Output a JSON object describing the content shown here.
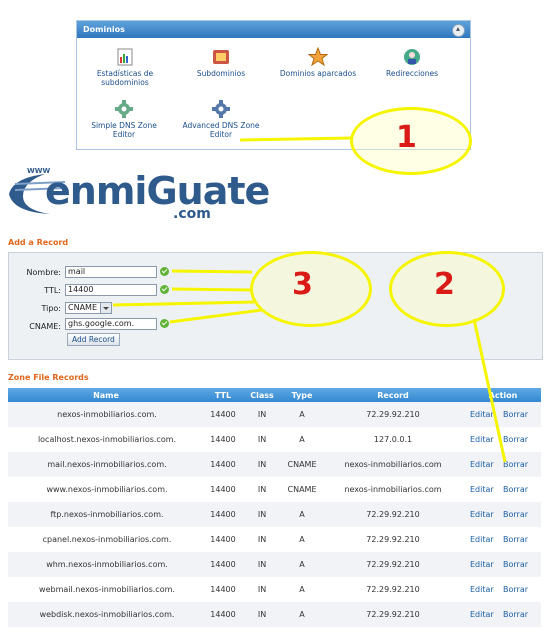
{
  "dominios": {
    "title": "Dominios",
    "items": [
      {
        "label": "Estadísticas de subdominios",
        "icon": "stats-icon"
      },
      {
        "label": "Subdominios",
        "icon": "subdomains-icon"
      },
      {
        "label": "Dominios aparcados",
        "icon": "parked-domains-icon"
      },
      {
        "label": "Redirecciones",
        "icon": "redirects-icon"
      },
      {
        "label": "Simple DNS Zone Editor",
        "icon": "simple-dns-icon"
      },
      {
        "label": "Advanced DNS Zone Editor",
        "icon": "advanced-dns-icon"
      }
    ]
  },
  "logo": {
    "text": "enmiGuate",
    "suffix": ".com",
    "prefix": "WWW"
  },
  "add_record": {
    "title": "Add a Record",
    "fields": {
      "nombre": {
        "label": "Nombre:",
        "value": "mail"
      },
      "ttl": {
        "label": "TTL:",
        "value": "14400"
      },
      "tipo": {
        "label": "Tipo:",
        "value": "CNAME"
      },
      "cname": {
        "label": "CNAME:",
        "value": "ghs.google.com."
      }
    },
    "button": "Add Record"
  },
  "zone": {
    "title": "Zone File Records",
    "headers": [
      "Name",
      "TTL",
      "Class",
      "Type",
      "Record",
      "Action"
    ],
    "rows": [
      [
        "nexos-inmobiliarios.com.",
        "14400",
        "IN",
        "A",
        "72.29.92.210"
      ],
      [
        "localhost.nexos-inmobiliarios.com.",
        "14400",
        "IN",
        "A",
        "127.0.0.1"
      ],
      [
        "mail.nexos-inmobiliarios.com.",
        "14400",
        "IN",
        "CNAME",
        "nexos-inmobiliarios.com"
      ],
      [
        "www.nexos-inmobiliarios.com.",
        "14400",
        "IN",
        "CNAME",
        "nexos-inmobiliarios.com"
      ],
      [
        "ftp.nexos-inmobiliarios.com.",
        "14400",
        "IN",
        "A",
        "72.29.92.210"
      ],
      [
        "cpanel.nexos-inmobiliarios.com.",
        "14400",
        "IN",
        "A",
        "72.29.92.210"
      ],
      [
        "whm.nexos-inmobiliarios.com.",
        "14400",
        "IN",
        "A",
        "72.29.92.210"
      ],
      [
        "webmail.nexos-inmobiliarios.com.",
        "14400",
        "IN",
        "A",
        "72.29.92.210"
      ],
      [
        "webdisk.nexos-inmobiliarios.com.",
        "14400",
        "IN",
        "A",
        "72.29.92.210"
      ]
    ],
    "edit_label": "Editar",
    "delete_label": "Borrar"
  },
  "annotations": {
    "one": "1",
    "two": "2",
    "three": "3"
  },
  "colors": {
    "accent_orange": "#e0661b",
    "header_blue": "#3389d1",
    "highlight_yellow": "#f6f500",
    "number_red": "#d91a17"
  }
}
